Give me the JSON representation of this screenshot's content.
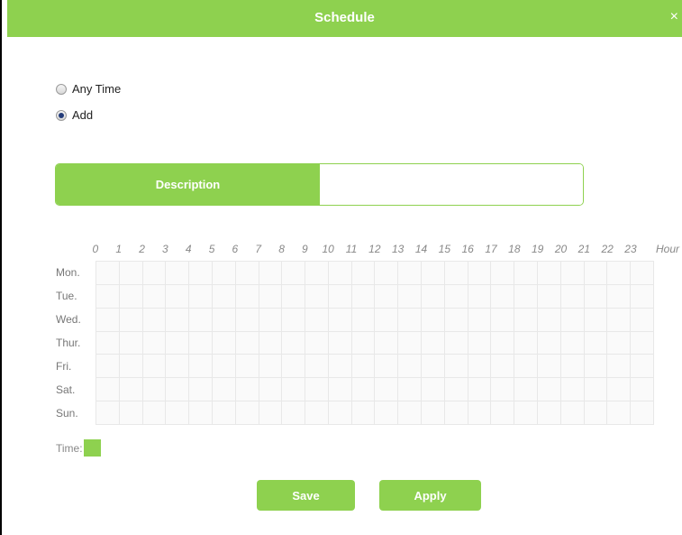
{
  "dialog": {
    "title": "Schedule",
    "close_glyph": "×"
  },
  "mode": {
    "options": [
      {
        "label": "Any Time",
        "checked": false
      },
      {
        "label": "Add",
        "checked": true
      }
    ]
  },
  "description": {
    "label": "Description",
    "value": ""
  },
  "schedule": {
    "hours": [
      "0",
      "1",
      "2",
      "3",
      "4",
      "5",
      "6",
      "7",
      "8",
      "9",
      "10",
      "11",
      "12",
      "13",
      "14",
      "15",
      "16",
      "17",
      "18",
      "19",
      "20",
      "21",
      "22",
      "23"
    ],
    "hour_unit": "Hour",
    "days": [
      "Mon.",
      "Tue.",
      "Wed.",
      "Thur.",
      "Fri.",
      "Sat.",
      "Sun."
    ],
    "selected_cells": []
  },
  "legend": {
    "label": "Time:",
    "color": "#8ed14f"
  },
  "buttons": {
    "save": "Save",
    "apply": "Apply"
  },
  "colors": {
    "accent": "#8ed14f",
    "grid_line": "#e8e8e8"
  }
}
